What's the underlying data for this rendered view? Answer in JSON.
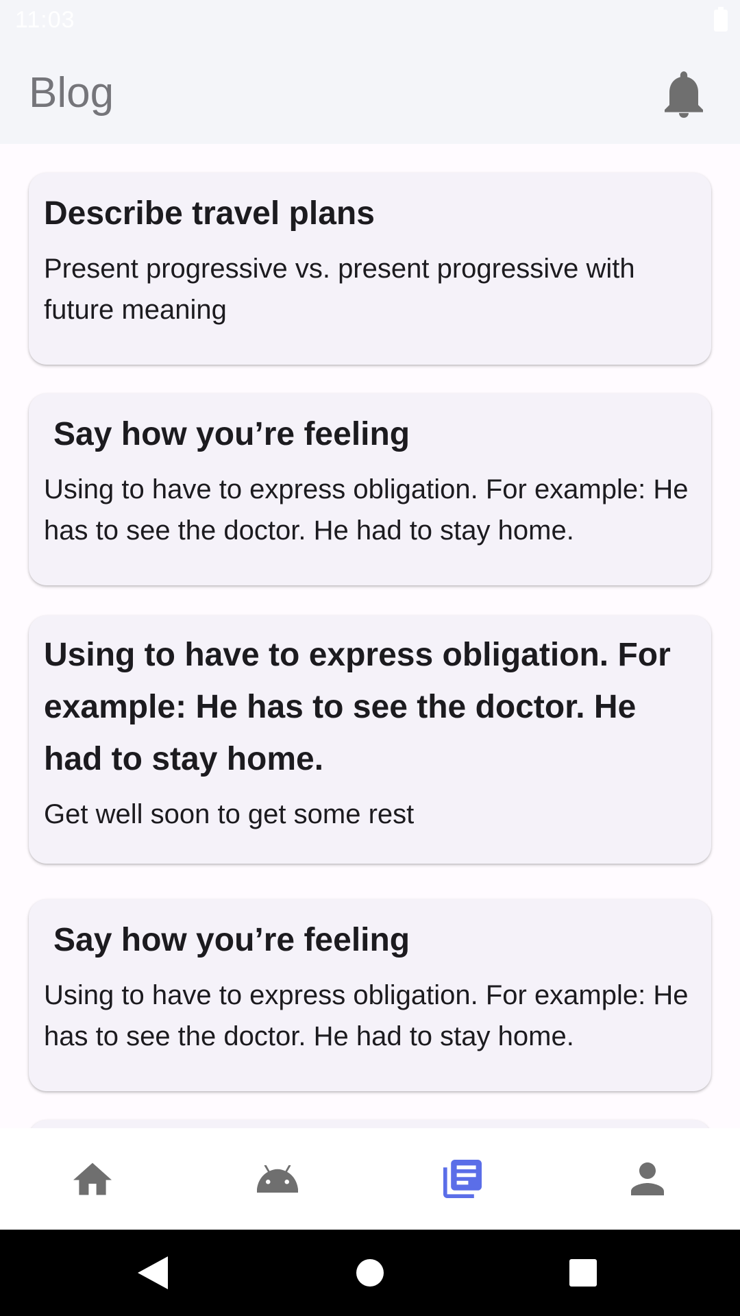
{
  "status_bar": {
    "time": "11:03"
  },
  "app_bar": {
    "title": "Blog",
    "notification_icon": "bell-icon"
  },
  "posts": [
    {
      "title": "Describe travel plans",
      "body": "Present progressive vs. present progressive with future meaning"
    },
    {
      "title": "Say how you’re feeling",
      "body": "Using to have to express obligation. For example: He has to see the doctor. He had to stay home."
    },
    {
      "title": "Using to have to express obligation. For example: He has to see the doctor. He had to stay home.",
      "body": "Get well soon to get some rest"
    },
    {
      "title": "Say how you’re feeling",
      "body": "Using to have to express obligation. For example: He has to see the doctor. He had to stay home."
    }
  ],
  "bottom_nav": {
    "items": [
      {
        "icon": "home-icon",
        "selected": false
      },
      {
        "icon": "android-icon",
        "selected": false
      },
      {
        "icon": "article-icon",
        "selected": true
      },
      {
        "icon": "person-icon",
        "selected": false
      }
    ],
    "active_color": "#5b6ee8",
    "inactive_color": "#6f6f6f"
  },
  "system_nav": {
    "icons": [
      "back-icon",
      "home-circle-icon",
      "recents-icon"
    ]
  }
}
